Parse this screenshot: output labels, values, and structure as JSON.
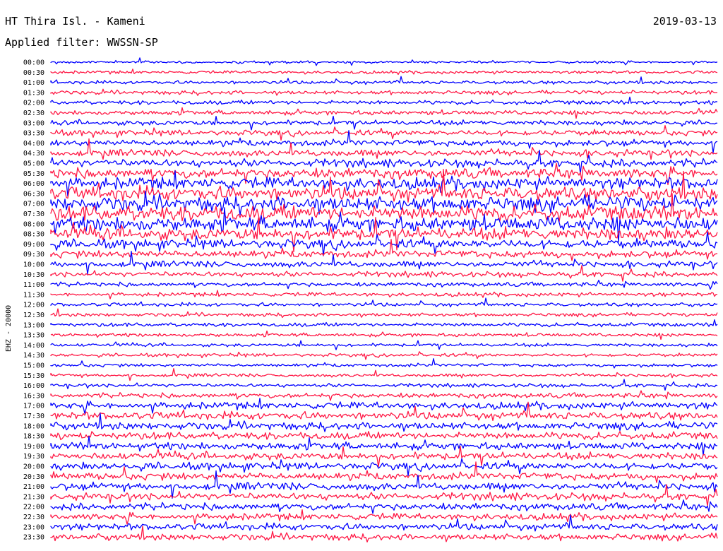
{
  "header": {
    "station": "HT Thira Isl. - Kameni",
    "date": "2019-03-13",
    "filter_label": "Applied filter:",
    "filter_value": "WWSSN-SP"
  },
  "chart_data": {
    "type": "line",
    "title": "HT Thira Isl. - Kameni",
    "ylabel": "EHZ - 20000",
    "xlabel": "",
    "row_labels": [
      "00:00",
      "00:30",
      "01:00",
      "01:30",
      "02:00",
      "02:30",
      "03:00",
      "03:30",
      "04:00",
      "04:30",
      "05:00",
      "05:30",
      "06:00",
      "06:30",
      "07:00",
      "07:30",
      "08:00",
      "08:30",
      "09:00",
      "09:30",
      "10:00",
      "10:30",
      "11:00",
      "11:30",
      "12:00",
      "12:30",
      "13:00",
      "13:30",
      "14:00",
      "14:30",
      "15:00",
      "15:30",
      "16:00",
      "16:30",
      "17:00",
      "17:30",
      "18:00",
      "18:30",
      "19:00",
      "19:30",
      "20:00",
      "20:30",
      "21:00",
      "21:30",
      "22:00",
      "22:30",
      "23:00",
      "23:30"
    ],
    "row_amplitude": [
      0.14,
      0.18,
      0.2,
      0.24,
      0.26,
      0.28,
      0.3,
      0.34,
      0.38,
      0.42,
      0.48,
      0.62,
      0.72,
      0.82,
      0.9,
      0.95,
      0.9,
      0.75,
      0.55,
      0.45,
      0.38,
      0.32,
      0.26,
      0.24,
      0.22,
      0.22,
      0.24,
      0.22,
      0.2,
      0.2,
      0.2,
      0.2,
      0.22,
      0.3,
      0.42,
      0.46,
      0.46,
      0.46,
      0.46,
      0.44,
      0.44,
      0.44,
      0.46,
      0.44,
      0.42,
      0.4,
      0.4,
      0.4
    ],
    "series_colors": [
      "#0000ff",
      "#ff1744"
    ],
    "grid": false
  }
}
